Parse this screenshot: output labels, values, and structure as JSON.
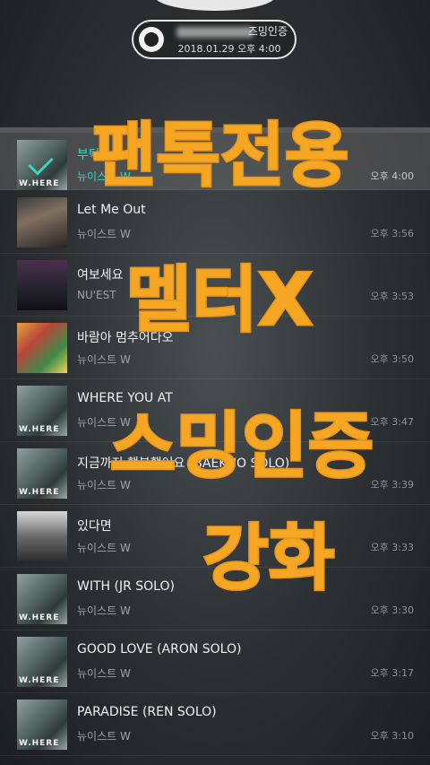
{
  "badge": {
    "title": "즈밍인증",
    "timestamp": "2018.01.29 오후 4:00"
  },
  "songs": [
    {
      "title": "부탁",
      "artist": "뉴이스트 W",
      "time": "오후 4:00",
      "art": "where",
      "active": true
    },
    {
      "title": "Let Me Out",
      "artist": "뉴이스트 W",
      "time": "오후 3:56",
      "art": "portrait"
    },
    {
      "title": "여보세요",
      "artist": "NU'EST",
      "time": "오후 3:53",
      "art": "group"
    },
    {
      "title": "바람아 멈추어다오",
      "artist": "뉴이스트 W",
      "time": "오후 3:50",
      "art": "colorful"
    },
    {
      "title": "WHERE YOU AT",
      "artist": "뉴이스트 W",
      "time": "오후 3:47",
      "art": "where"
    },
    {
      "title": "지금까지 행복했어요 (BAEKHO SOLO)",
      "artist": "뉴이스트 W",
      "time": "오후 3:39",
      "art": "where"
    },
    {
      "title": "있다면",
      "artist": "뉴이스트 W",
      "time": "오후 3:33",
      "art": "bw"
    },
    {
      "title": "WITH (JR SOLO)",
      "artist": "뉴이스트 W",
      "time": "오후 3:30",
      "art": "where"
    },
    {
      "title": "GOOD LOVE (ARON SOLO)",
      "artist": "뉴이스트 W",
      "time": "오후 3:17",
      "art": "where"
    },
    {
      "title": "PARADISE (REN SOLO)",
      "artist": "뉴이스트 W",
      "time": "오후 3:10",
      "art": "where"
    }
  ],
  "overlay_text": {
    "line1": "팬톡전용",
    "line2": "멜터X",
    "line3": "스밍인증",
    "line4": "강화"
  },
  "colors": {
    "accent": "#3fd3c3",
    "overlay": "#f5a623"
  }
}
